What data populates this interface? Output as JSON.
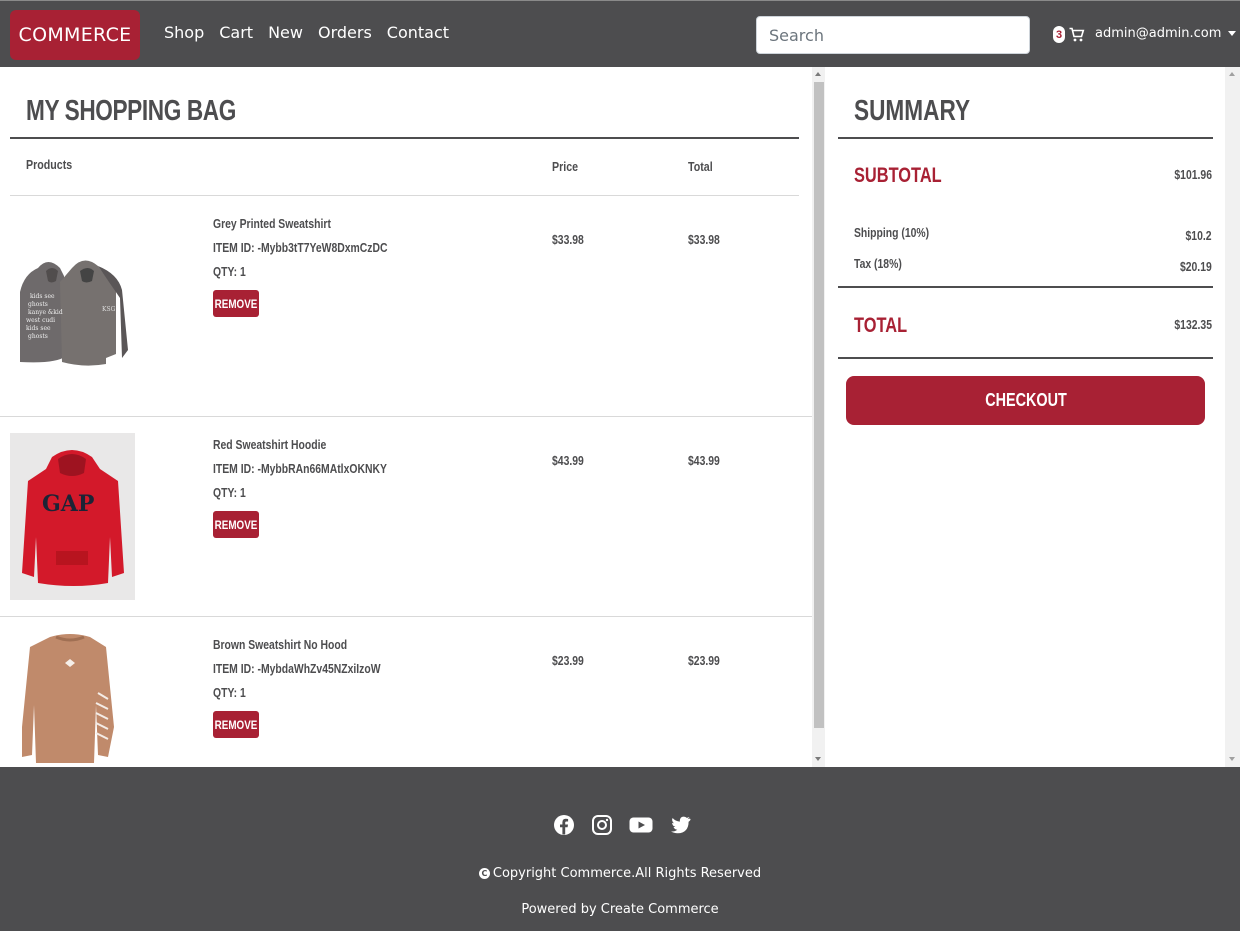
{
  "navbar": {
    "brand": "COMMERCE",
    "links": [
      "Shop",
      "Cart",
      "New",
      "Orders",
      "Contact"
    ],
    "search_placeholder": "Search",
    "cart_count": "3",
    "user_email": "admin@admin.com"
  },
  "bag": {
    "title": "MY SHOPPING BAG",
    "columns": {
      "products": "Products",
      "price": "Price",
      "total": "Total"
    },
    "remove_label": "REMOVE",
    "items": [
      {
        "name": "Grey Printed Sweatshirt",
        "item_id": "ITEM ID: -Mybb3tT7YeW8DxmCzDC",
        "qty": "QTY: 1",
        "price": "$33.98",
        "total": "$33.98"
      },
      {
        "name": "Red Sweatshirt Hoodie",
        "item_id": "ITEM ID: -MybbRAn66MAtlxOKNKY",
        "qty": "QTY: 1",
        "price": "$43.99",
        "total": "$43.99"
      },
      {
        "name": "Brown Sweatshirt No Hood",
        "item_id": "ITEM ID: -MybdaWhZv45NZxiIzoW",
        "qty": "QTY: 1",
        "price": "$23.99",
        "total": "$23.99"
      }
    ]
  },
  "summary": {
    "title": "SUMMARY",
    "subtotal_label": "SUBTOTAL",
    "subtotal_value": "$101.96",
    "shipping_label": "Shipping (10%)",
    "shipping_value": "$10.2",
    "tax_label": "Tax (18%)",
    "tax_value": "$20.19",
    "total_label": "TOTAL",
    "total_value": "$132.35",
    "checkout_label": "CHECKOUT"
  },
  "footer": {
    "social_icons": [
      "facebook-icon",
      "instagram-icon",
      "youtube-icon",
      "twitter-icon"
    ],
    "copyright": "Copyright Commerce.All Rights Reserved",
    "powered_by": "Powered by Create Commerce"
  },
  "colors": {
    "brand": "#a82134",
    "dark": "#4d4d4f"
  }
}
